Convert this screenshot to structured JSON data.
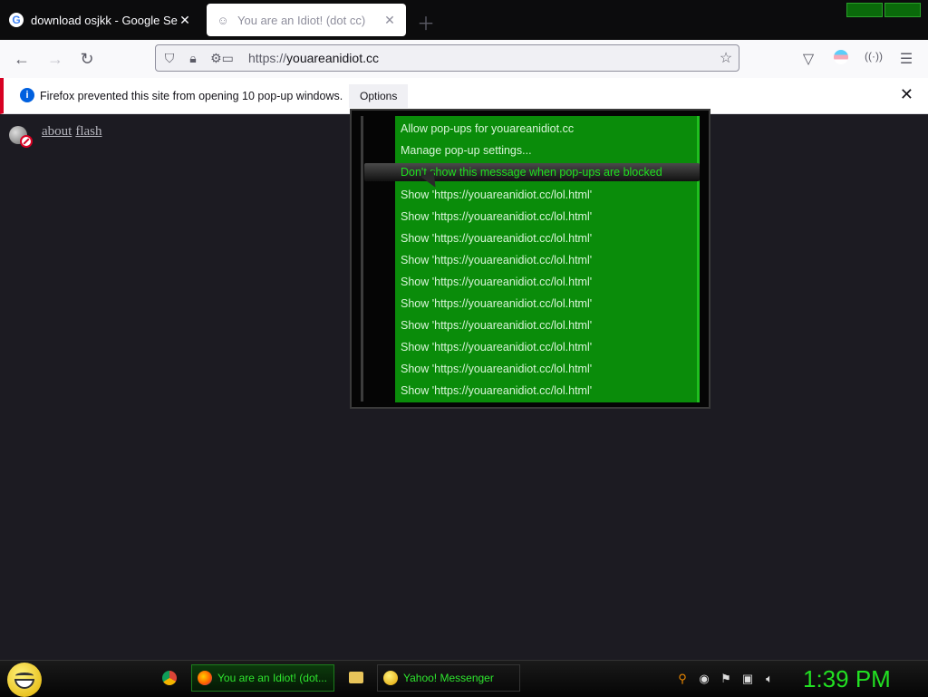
{
  "tabs": [
    {
      "title": "download osjkk - Google Search",
      "icon": "google-icon"
    },
    {
      "title": "You are an Idiot! (dot cc)",
      "icon": "smiley-icon"
    }
  ],
  "urlbar": {
    "prefix": "https://",
    "host": "youareanidiot.cc"
  },
  "notification": {
    "message": "Firefox prevented this site from opening 10 pop-up windows.",
    "options_label": "Options"
  },
  "page": {
    "about_link": "about",
    "flash_link": "flash"
  },
  "popup_menu": {
    "items": [
      "Allow pop-ups for youareanidiot.cc",
      "Manage pop-up settings...",
      "Don't show this message when pop-ups are blocked",
      "Show 'https://youareanidiot.cc/lol.html'",
      "Show 'https://youareanidiot.cc/lol.html'",
      "Show 'https://youareanidiot.cc/lol.html'",
      "Show 'https://youareanidiot.cc/lol.html'",
      "Show 'https://youareanidiot.cc/lol.html'",
      "Show 'https://youareanidiot.cc/lol.html'",
      "Show 'https://youareanidiot.cc/lol.html'",
      "Show 'https://youareanidiot.cc/lol.html'",
      "Show 'https://youareanidiot.cc/lol.html'",
      "Show 'https://youareanidiot.cc/lol.html'"
    ],
    "highlighted_index": 2
  },
  "taskbar": {
    "firefox_item": "You are an Idiot! (dot...",
    "yahoo_item": "Yahoo! Messenger",
    "clock": "1:39 PM"
  },
  "colors": {
    "menu_green": "#0a8c0a",
    "clock_green": "#22e022",
    "notification_accent": "#d70022"
  }
}
